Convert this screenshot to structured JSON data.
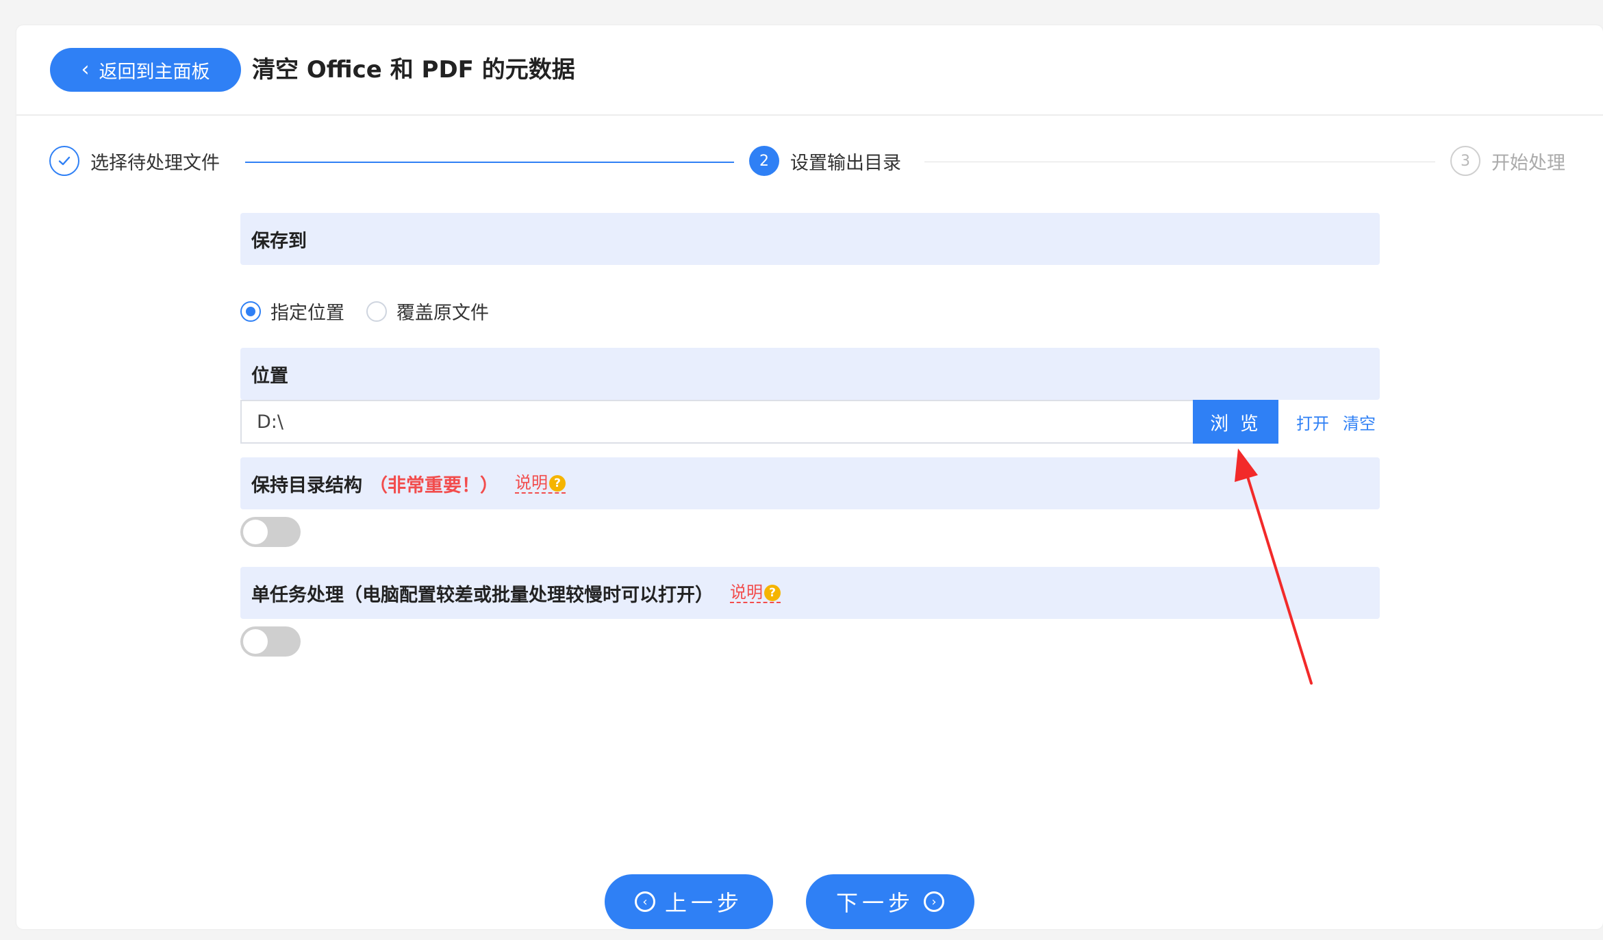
{
  "header": {
    "back_label": "返回到主面板",
    "title": "清空 Office 和 PDF 的元数据"
  },
  "steps": [
    {
      "number": "✓",
      "label": "选择待处理文件",
      "state": "done"
    },
    {
      "number": "2",
      "label": "设置输出目录",
      "state": "active"
    },
    {
      "number": "3",
      "label": "开始处理",
      "state": "pending"
    }
  ],
  "save_to": {
    "heading": "保存到",
    "options": [
      {
        "label": "指定位置",
        "checked": true
      },
      {
        "label": "覆盖原文件",
        "checked": false
      }
    ]
  },
  "location": {
    "heading": "位置",
    "value": "D:\\",
    "browse_label": "浏 览",
    "open_label": "打开",
    "clear_label": "清空"
  },
  "keep_structure": {
    "heading": "保持目录结构",
    "important": "（非常重要！）",
    "explain": "说明",
    "enabled": false
  },
  "single_task": {
    "heading": "单任务处理（电脑配置较差或批量处理较慢时可以打开）",
    "explain": "说明",
    "enabled": false
  },
  "nav": {
    "prev_label": "上一步",
    "next_label": "下一步"
  },
  "colors": {
    "accent": "#2f80f5",
    "section_bg": "#e8eefd",
    "warning": "#f24c4c",
    "annotation_arrow": "#f22a2a"
  }
}
